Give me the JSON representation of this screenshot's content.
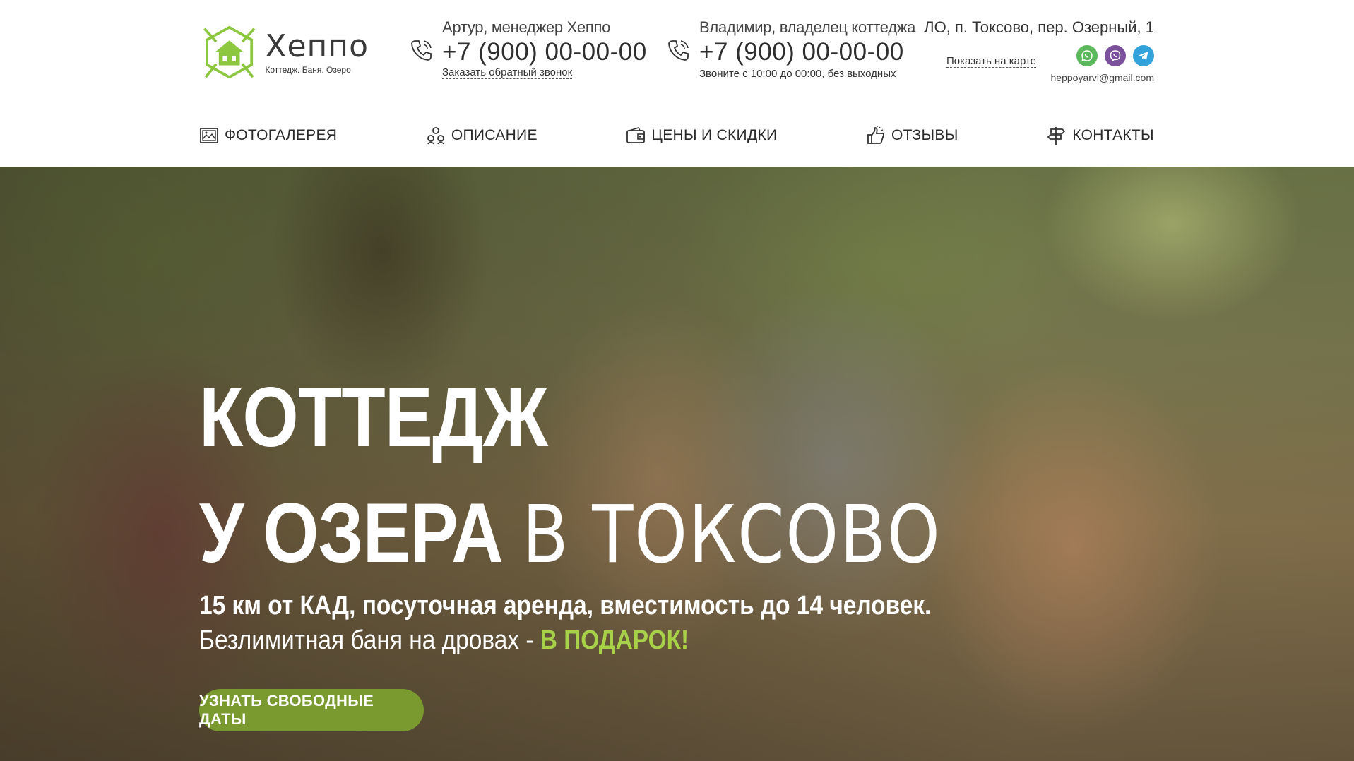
{
  "logo": {
    "name": "Хеппо",
    "tagline": "Коттедж. Баня. Озеро"
  },
  "contacts": [
    {
      "person": "Артур, менеджер Хеппо",
      "phone": "+7 (900) 00-00-00",
      "link": "Заказать обратный звонок"
    },
    {
      "person": "Владимир, владелец коттеджа",
      "phone": "+7 (900) 00-00-00",
      "note": "Звоните с 10:00 до 00:00, без выходных"
    }
  ],
  "address": {
    "text": "ЛО, п. Токсово, пер. Озерный, 1",
    "map_link": "Показать на карте",
    "email": "heppoyarvi@gmail.com",
    "messengers": [
      "whatsapp-icon",
      "viber-icon",
      "telegram-icon"
    ]
  },
  "nav": {
    "items": [
      {
        "label": "ФОТОГАЛЕРЕЯ",
        "icon": "gallery-icon"
      },
      {
        "label": "ОПИСАНИЕ",
        "icon": "description-icon"
      },
      {
        "label": "ЦЕНЫ И СКИДКИ",
        "icon": "wallet-icon"
      },
      {
        "label": "ОТЗЫВЫ",
        "icon": "reviews-icon"
      },
      {
        "label": "КОНТАКТЫ",
        "icon": "signpost-icon"
      }
    ]
  },
  "hero": {
    "title_line1": "КОТТЕДЖ",
    "title_line2_bold": "У ОЗЕРА",
    "title_line2_light": "В ТОКСОВО",
    "subtitle_1": "15 км от КАД, посуточная аренда, вместимость до 14 человек.",
    "subtitle_2_main": "Безлимитная баня на дровах - ",
    "subtitle_2_accent": "В ПОДАРОК!",
    "cta_label": "УЗНАТЬ СВОБОДНЫЕ ДАТЫ"
  },
  "colors": {
    "accent_green": "#7a9a2f",
    "accent_light_green": "#a8d14a",
    "logo_green": "#8dc63f"
  }
}
